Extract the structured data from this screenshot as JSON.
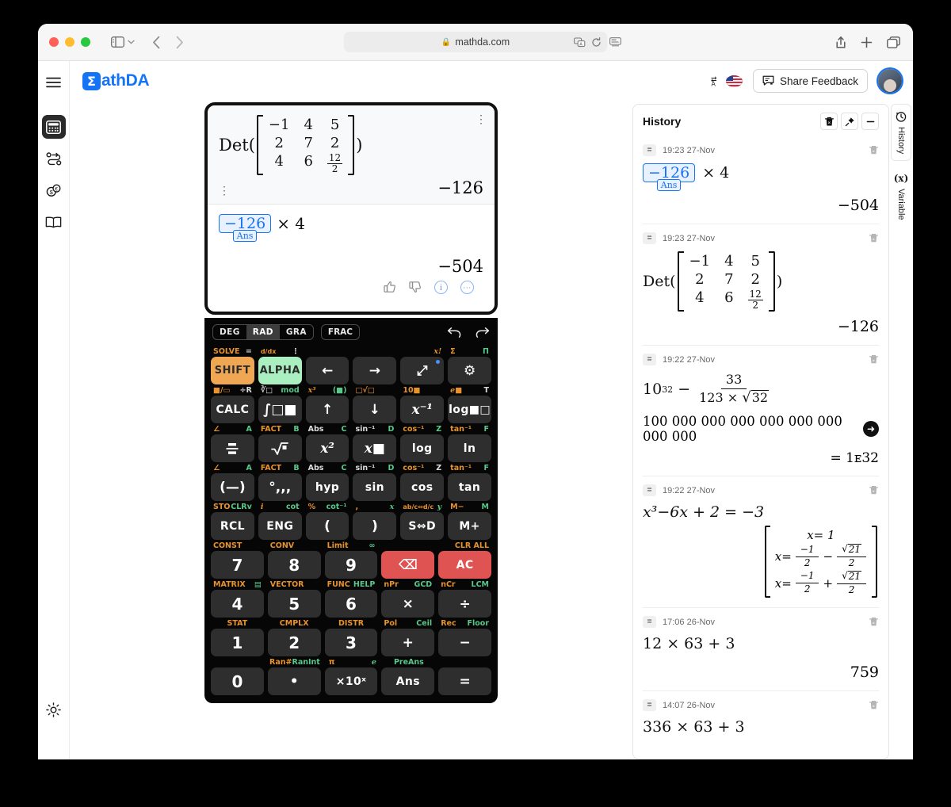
{
  "browser": {
    "url": "mathda.com",
    "lock_icon": "lock-icon",
    "sidebar_icon": "sidebar-toggle-icon",
    "back_icon": "back-chevron-icon",
    "forward_icon": "forward-chevron-icon",
    "reader_icon": "reader-view-icon",
    "translate_icon": "translate-icon",
    "reload_icon": "reload-icon",
    "share_icon": "share-icon",
    "newtab_icon": "new-tab-icon",
    "tabs_icon": "show-tabs-icon"
  },
  "rail": {
    "items": [
      {
        "name": "menu-icon",
        "label": "Menu"
      },
      {
        "name": "calculator-icon",
        "label": "Calculator"
      },
      {
        "name": "unit-converter-icon",
        "label": "Unit Converter"
      },
      {
        "name": "currency-converter-icon",
        "label": "Currency Converter"
      },
      {
        "name": "dictionary-icon",
        "label": "Dictionary"
      }
    ],
    "theme_icon": "sun-theme-icon"
  },
  "header": {
    "brand_mark": "Σ",
    "brand_text": "athDA",
    "brand_color": "#1574f5",
    "language_icon": "translate-language-icon",
    "flag": "us-flag-icon",
    "feedback_label": "Share Feedback",
    "feedback_icon": "feedback-chat-icon",
    "avatar": "user-avatar"
  },
  "display": {
    "previous": {
      "function": "Det(",
      "close_paren": ")",
      "matrix": [
        [
          "−1",
          "4",
          "5"
        ],
        [
          "2",
          "7",
          "2"
        ],
        [
          "4",
          "6",
          {
            "num": "12",
            "den": "2"
          }
        ]
      ],
      "result": "−126"
    },
    "current": {
      "ans_value": "−126",
      "ans_label": "Ans",
      "operator": "× 4",
      "result": "−504"
    },
    "feedback": [
      "thumbs-up-icon",
      "thumbs-down-icon",
      "info-icon",
      "more-icon"
    ]
  },
  "keypad": {
    "modes": [
      {
        "label": "DEG",
        "active": false
      },
      {
        "label": "RAD",
        "active": true
      },
      {
        "label": "GRA",
        "active": false
      }
    ],
    "frac_label": "FRAC",
    "undo_icon": "undo-icon",
    "redo_icon": "redo-icon",
    "label_rows": [
      [
        [
          "SOLVE",
          "o"
        ],
        [
          "=",
          "o"
        ],
        [
          "d/dx■",
          "o"
        ],
        [
          "⋮",
          "w"
        ],
        [
          "",
          ""
        ],
        [
          "",
          ""
        ],
        [
          "",
          ""
        ],
        [
          "x!",
          "o"
        ],
        [
          "Σ",
          "o"
        ],
        [
          "Π",
          "gr"
        ]
      ],
      [],
      []
    ],
    "rows": [
      {
        "labels": [
          {
            "l": "SOLVE",
            "lc": "o",
            "r": "=",
            "rc": "w"
          },
          {
            "l": "d/dx",
            "lc": "o",
            "r": "⋮",
            "rc": "w"
          },
          {
            "l": "",
            "lc": "o",
            "r": "",
            "rc": "w"
          },
          {
            "l": "",
            "lc": "o",
            "r": "",
            "rc": "w"
          },
          {
            "l": "",
            "lc": "o",
            "r": "x!",
            "rc": "o"
          },
          {
            "l": "Σ",
            "lc": "o",
            "r": "Π",
            "rc": "gr"
          }
        ],
        "keys": [
          {
            "t": "SHIFT",
            "s": "shift"
          },
          {
            "t": "ALPHA",
            "s": "alpha"
          },
          {
            "t": "←",
            "s": ""
          },
          {
            "t": "→",
            "s": ""
          },
          {
            "t": "⤢",
            "s": "",
            "badge": true
          },
          {
            "t": "⚙",
            "s": ""
          }
        ]
      },
      {
        "labels": [
          {
            "l": "■/▭",
            "lc": "o",
            "r": "÷R",
            "rc": "w"
          },
          {
            "l": "∛□",
            "lc": "w",
            "r": "mod",
            "rc": "gr"
          },
          {
            "l": "x³",
            "lc": "o",
            "r": "(■)",
            "rc": "gr"
          },
          {
            "l": "□√□",
            "lc": "o",
            "r": "",
            "rc": "w"
          },
          {
            "l": "10■",
            "lc": "o",
            "r": "",
            "rc": "w"
          },
          {
            "l": "e■",
            "lc": "o",
            "r": "T",
            "rc": "w"
          }
        ],
        "keys": [
          {
            "t": "CALC",
            "s": "sm"
          },
          {
            "t": "∫□■",
            "s": ""
          },
          {
            "t": "↑",
            "s": ""
          },
          {
            "t": "↓",
            "s": ""
          },
          {
            "t": "x⁻¹",
            "s": "ital"
          },
          {
            "t": "log■□",
            "s": "sm"
          }
        ]
      },
      {
        "labels": [
          {
            "l": "∠",
            "lc": "o",
            "r": "A",
            "rc": "gr"
          },
          {
            "l": "FACT",
            "lc": "o",
            "r": "B",
            "rc": "gr"
          },
          {
            "l": "Abs",
            "lc": "w",
            "r": "C",
            "rc": "gr"
          },
          {
            "l": "sin⁻¹",
            "lc": "w",
            "r": "D",
            "rc": "gr"
          },
          {
            "l": "cos⁻¹",
            "lc": "o",
            "r": "Z",
            "rc": "w"
          },
          {
            "l": "tan⁻¹",
            "lc": "o",
            "r": "F",
            "rc": "gr"
          }
        ],
        "keys": [
          {
            "t": "(—)",
            "s": ""
          },
          {
            "t": "°,,,",
            "s": ""
          },
          {
            "t": "hyp",
            "s": ""
          },
          {
            "t": "sin",
            "s": ""
          },
          {
            "t": "cos",
            "s": ""
          },
          {
            "t": "tan",
            "s": ""
          }
        ]
      },
      {
        "labels": [
          {
            "l": "STO",
            "lc": "o",
            "r": "CLRv",
            "rc": "gr"
          },
          {
            "l": "i",
            "lc": "o",
            "r": "cot",
            "rc": "gr"
          },
          {
            "l": "%",
            "lc": "o",
            "r": "cot⁻¹",
            "rc": "gr"
          },
          {
            "l": ",",
            "lc": "o",
            "r": "x",
            "rc": "gr"
          },
          {
            "l": "ab/c⇔d/c",
            "lc": "o",
            "r": "y",
            "rc": "gr"
          },
          {
            "l": "M−",
            "lc": "o",
            "r": "M",
            "rc": "gr"
          }
        ],
        "keys": [
          {
            "t": "RCL",
            "s": ""
          },
          {
            "t": "ENG",
            "s": ""
          },
          {
            "t": "(",
            "s": ""
          },
          {
            "t": ")",
            "s": ""
          },
          {
            "t": "S⇔D",
            "s": ""
          },
          {
            "t": "M+",
            "s": ""
          }
        ]
      },
      {
        "labels": [
          {
            "l": "CONST",
            "lc": "o",
            "r": "",
            "rc": "w"
          },
          {
            "l": "CONV",
            "lc": "o",
            "r": "",
            "rc": "w"
          },
          {
            "l": "Limit",
            "lc": "o",
            "r": "",
            "rc": "w"
          },
          {
            "l": "∞",
            "lc": "gr",
            "r": "",
            "rc": "w"
          },
          {
            "l": "",
            "lc": "o",
            "r": "",
            "rc": "w"
          },
          {
            "l": "CLR ALL",
            "lc": "o",
            "r": "",
            "rc": "w"
          }
        ],
        "keys": [
          {
            "t": "7",
            "s": "num"
          },
          {
            "t": "8",
            "s": "num"
          },
          {
            "t": "9",
            "s": "num"
          },
          {
            "t": "⌫",
            "s": "red"
          },
          {
            "t": "AC",
            "s": "red"
          }
        ]
      },
      {
        "labels": [
          {
            "l": "MATRIX",
            "lc": "o",
            "r": "▤",
            "rc": "gr"
          },
          {
            "l": "VECTOR",
            "lc": "o",
            "r": "",
            "rc": "w"
          },
          {
            "l": "FUNC",
            "lc": "o",
            "r": "HELP",
            "rc": "gr"
          },
          {
            "l": "nPr",
            "lc": "o",
            "r": "GCD",
            "rc": "gr"
          },
          {
            "l": "nCr",
            "lc": "o",
            "r": "LCM",
            "rc": "gr"
          }
        ],
        "keys": [
          {
            "t": "4",
            "s": "num"
          },
          {
            "t": "5",
            "s": "num"
          },
          {
            "t": "6",
            "s": "num"
          },
          {
            "t": "×",
            "s": ""
          },
          {
            "t": "÷",
            "s": ""
          }
        ]
      },
      {
        "labels": [
          {
            "l": "STAT",
            "lc": "o",
            "r": "",
            "rc": "w"
          },
          {
            "l": "CMPLX",
            "lc": "o",
            "r": "",
            "rc": "w"
          },
          {
            "l": "DISTR",
            "lc": "o",
            "r": "",
            "rc": "w"
          },
          {
            "l": "Pol",
            "lc": "o",
            "r": "Ceil",
            "rc": "gr"
          },
          {
            "l": "Rec",
            "lc": "o",
            "r": "Floor",
            "rc": "gr"
          }
        ],
        "keys": [
          {
            "t": "1",
            "s": "num"
          },
          {
            "t": "2",
            "s": "num"
          },
          {
            "t": "3",
            "s": "num"
          },
          {
            "t": "+",
            "s": ""
          },
          {
            "t": "−",
            "s": ""
          }
        ]
      },
      {
        "labels": [
          {
            "l": "",
            "lc": "o",
            "r": "",
            "rc": "w"
          },
          {
            "l": "Ran#",
            "lc": "o",
            "r": "RanInt",
            "rc": "gr"
          },
          {
            "l": "π",
            "lc": "o",
            "r": "e",
            "rc": "gr"
          },
          {
            "l": "PreAns",
            "lc": "gr",
            "r": "",
            "rc": "w"
          },
          {
            "l": "",
            "lc": "o",
            "r": "",
            "rc": "w"
          }
        ],
        "keys": [
          {
            "t": "0",
            "s": "num"
          },
          {
            "t": "•",
            "s": ""
          },
          {
            "t": "×10ˣ",
            "s": ""
          },
          {
            "t": "Ans",
            "s": "sm"
          },
          {
            "t": "=",
            "s": ""
          }
        ]
      }
    ]
  },
  "history": {
    "title": "History",
    "actions": [
      {
        "name": "clear-history-button",
        "icon": "trash-icon"
      },
      {
        "name": "pin-history-button",
        "icon": "pin-icon"
      },
      {
        "name": "minimize-history-button",
        "icon": "minimize-icon"
      }
    ],
    "items": [
      {
        "time": "19:23 27-Nov",
        "kind": "ans",
        "ans_value": "−126",
        "ans_label": "Ans",
        "operator": "× 4",
        "result": "−504"
      },
      {
        "time": "19:23 27-Nov",
        "kind": "matrix",
        "function": "Det(",
        "close_paren": ")",
        "matrix": [
          [
            "−1",
            "4",
            "5"
          ],
          [
            "2",
            "7",
            "2"
          ],
          [
            "4",
            "6",
            {
              "num": "12",
              "den": "2"
            }
          ]
        ],
        "result": "−126"
      },
      {
        "time": "19:22 27-Nov",
        "kind": "power-frac",
        "base": "10",
        "exp": "32",
        "minus": "−",
        "frac_num": "33",
        "frac_den_a": "123",
        "frac_den_times": "×",
        "frac_den_sqrt": "32",
        "big_result": "100 000 000 000 000 000 000 000 000",
        "sci_result": "= 1ᴇ32"
      },
      {
        "time": "19:22 27-Nov",
        "kind": "cubic",
        "expr": "x³−6x + 2 = −3",
        "solutions": [
          "x= 1",
          "x= −1/2 − √21/2",
          "x= −1/2 + √21/2"
        ]
      },
      {
        "time": "17:06 26-Nov",
        "kind": "simple",
        "expr": "12 × 63 + 3",
        "result": "759"
      },
      {
        "time": "14:07 26-Nov",
        "kind": "simple",
        "expr": "336 × 63 + 3",
        "result": ""
      }
    ]
  },
  "vtabs": [
    {
      "label": "History",
      "icon": "history-clock-icon",
      "selected": true
    },
    {
      "label": "Variable",
      "icon": "variable-x-icon",
      "selected": false
    }
  ]
}
